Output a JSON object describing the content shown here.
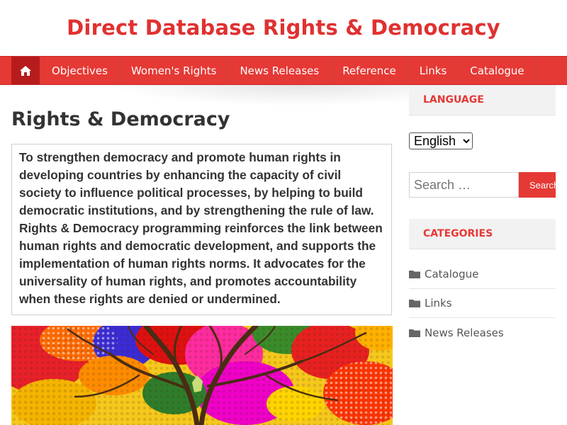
{
  "site": {
    "title": "Direct Database Rights & Democracy"
  },
  "nav": {
    "home_icon": "home-icon",
    "items": [
      "Objectives",
      "Women's Rights",
      "News Releases",
      "Reference",
      "Links",
      "Catalogue"
    ]
  },
  "main": {
    "title": "Rights & Democracy",
    "mission": "To strengthen democracy and promote human rights in developing countries by enhancing the capacity of civil society to influence political processes, by helping to build democratic institutions, and by strengthening the rule of law. Rights & Democracy programming reinforces the link between human rights and democratic development, and supports the implementation of human rights norms. It advocates for the universality of human rights, and promotes accountability when these rights are denied or undermined."
  },
  "sidebar": {
    "language": {
      "title": "Language",
      "selected": "English",
      "options": [
        "English"
      ]
    },
    "search": {
      "placeholder": "Search …",
      "button": "Search"
    },
    "categories": {
      "title": "Categories",
      "items": [
        "Catalogue",
        "Links",
        "News Releases"
      ],
      "icon": "folder-icon"
    }
  },
  "colors": {
    "accent": "#e53935",
    "accent_dark": "#b71c1c"
  }
}
